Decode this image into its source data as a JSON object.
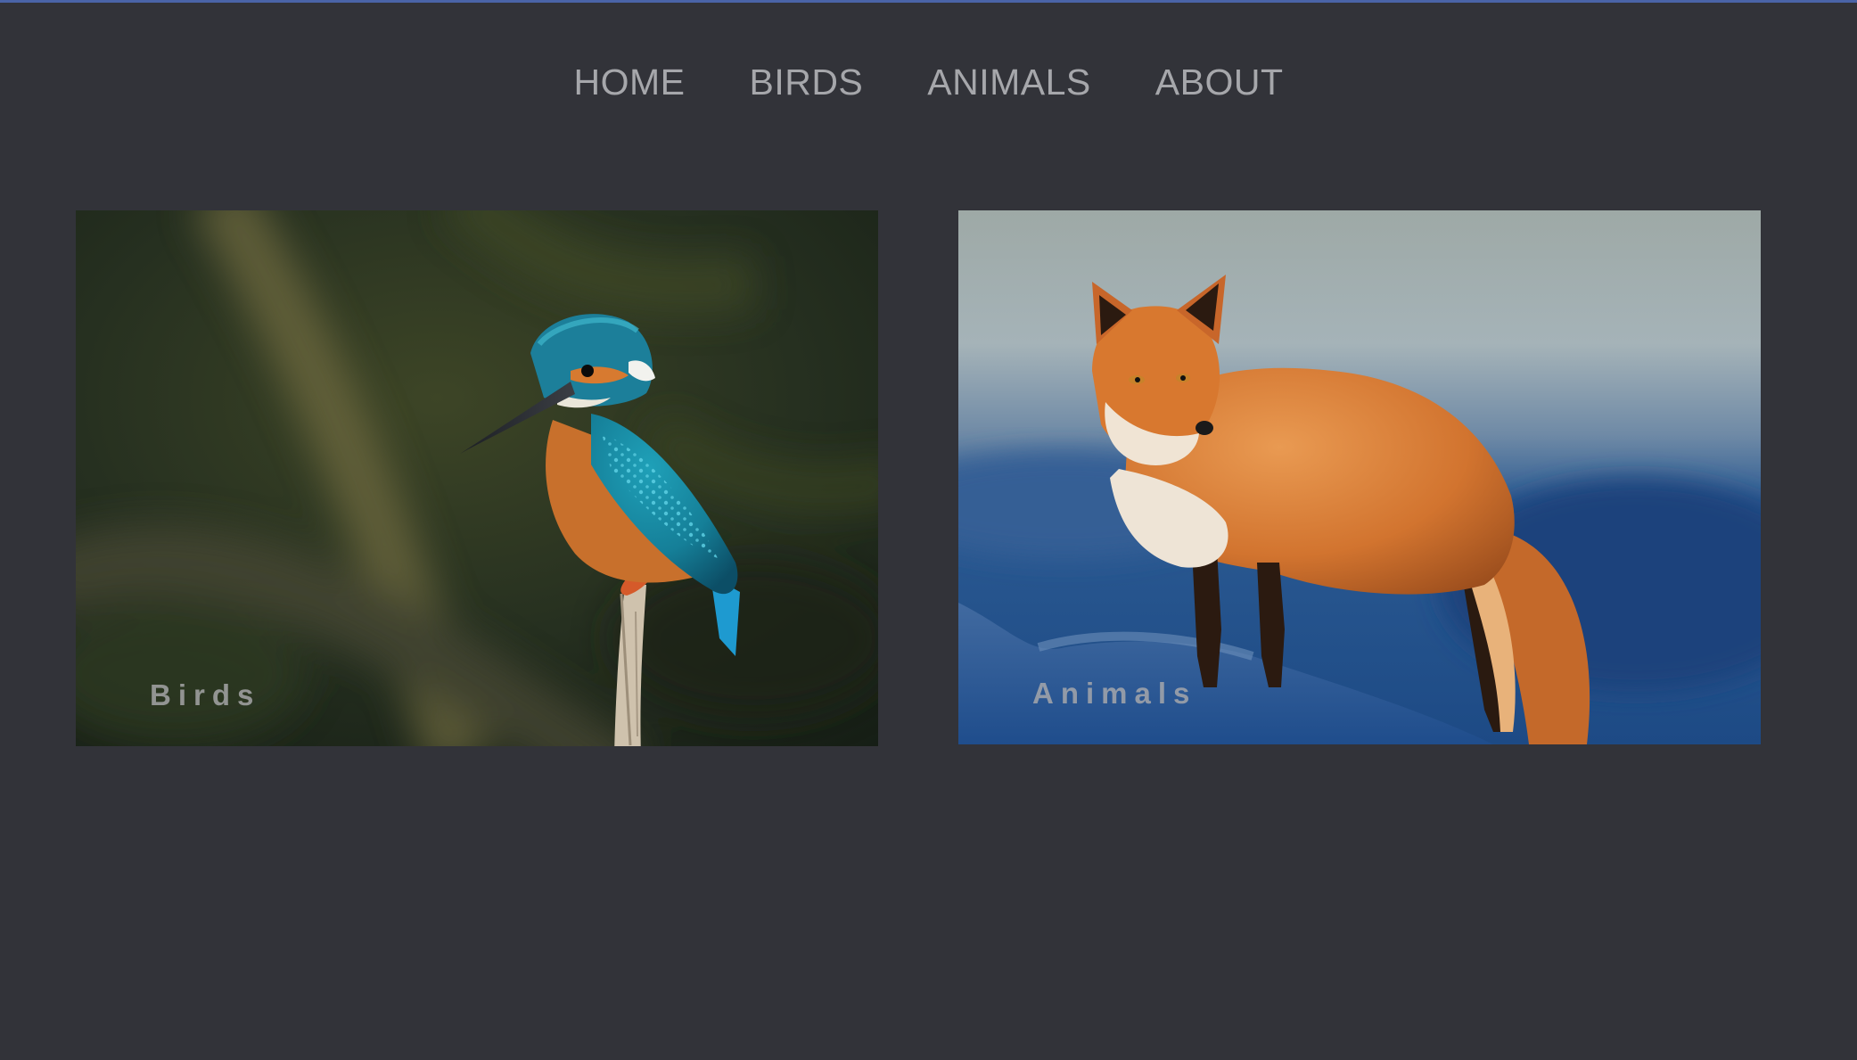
{
  "nav": {
    "items": [
      {
        "label": "HOME"
      },
      {
        "label": "BIRDS"
      },
      {
        "label": "ANIMALS"
      },
      {
        "label": "ABOUT"
      }
    ]
  },
  "cards": [
    {
      "label": "Birds",
      "image": "kingfisher-on-branch-photo"
    },
    {
      "label": "Animals",
      "image": "red-fox-in-snow-photo"
    }
  ],
  "colors": {
    "background": "#323339",
    "nav_text": "#a6a7ab",
    "top_accent": "#4a64a8"
  }
}
